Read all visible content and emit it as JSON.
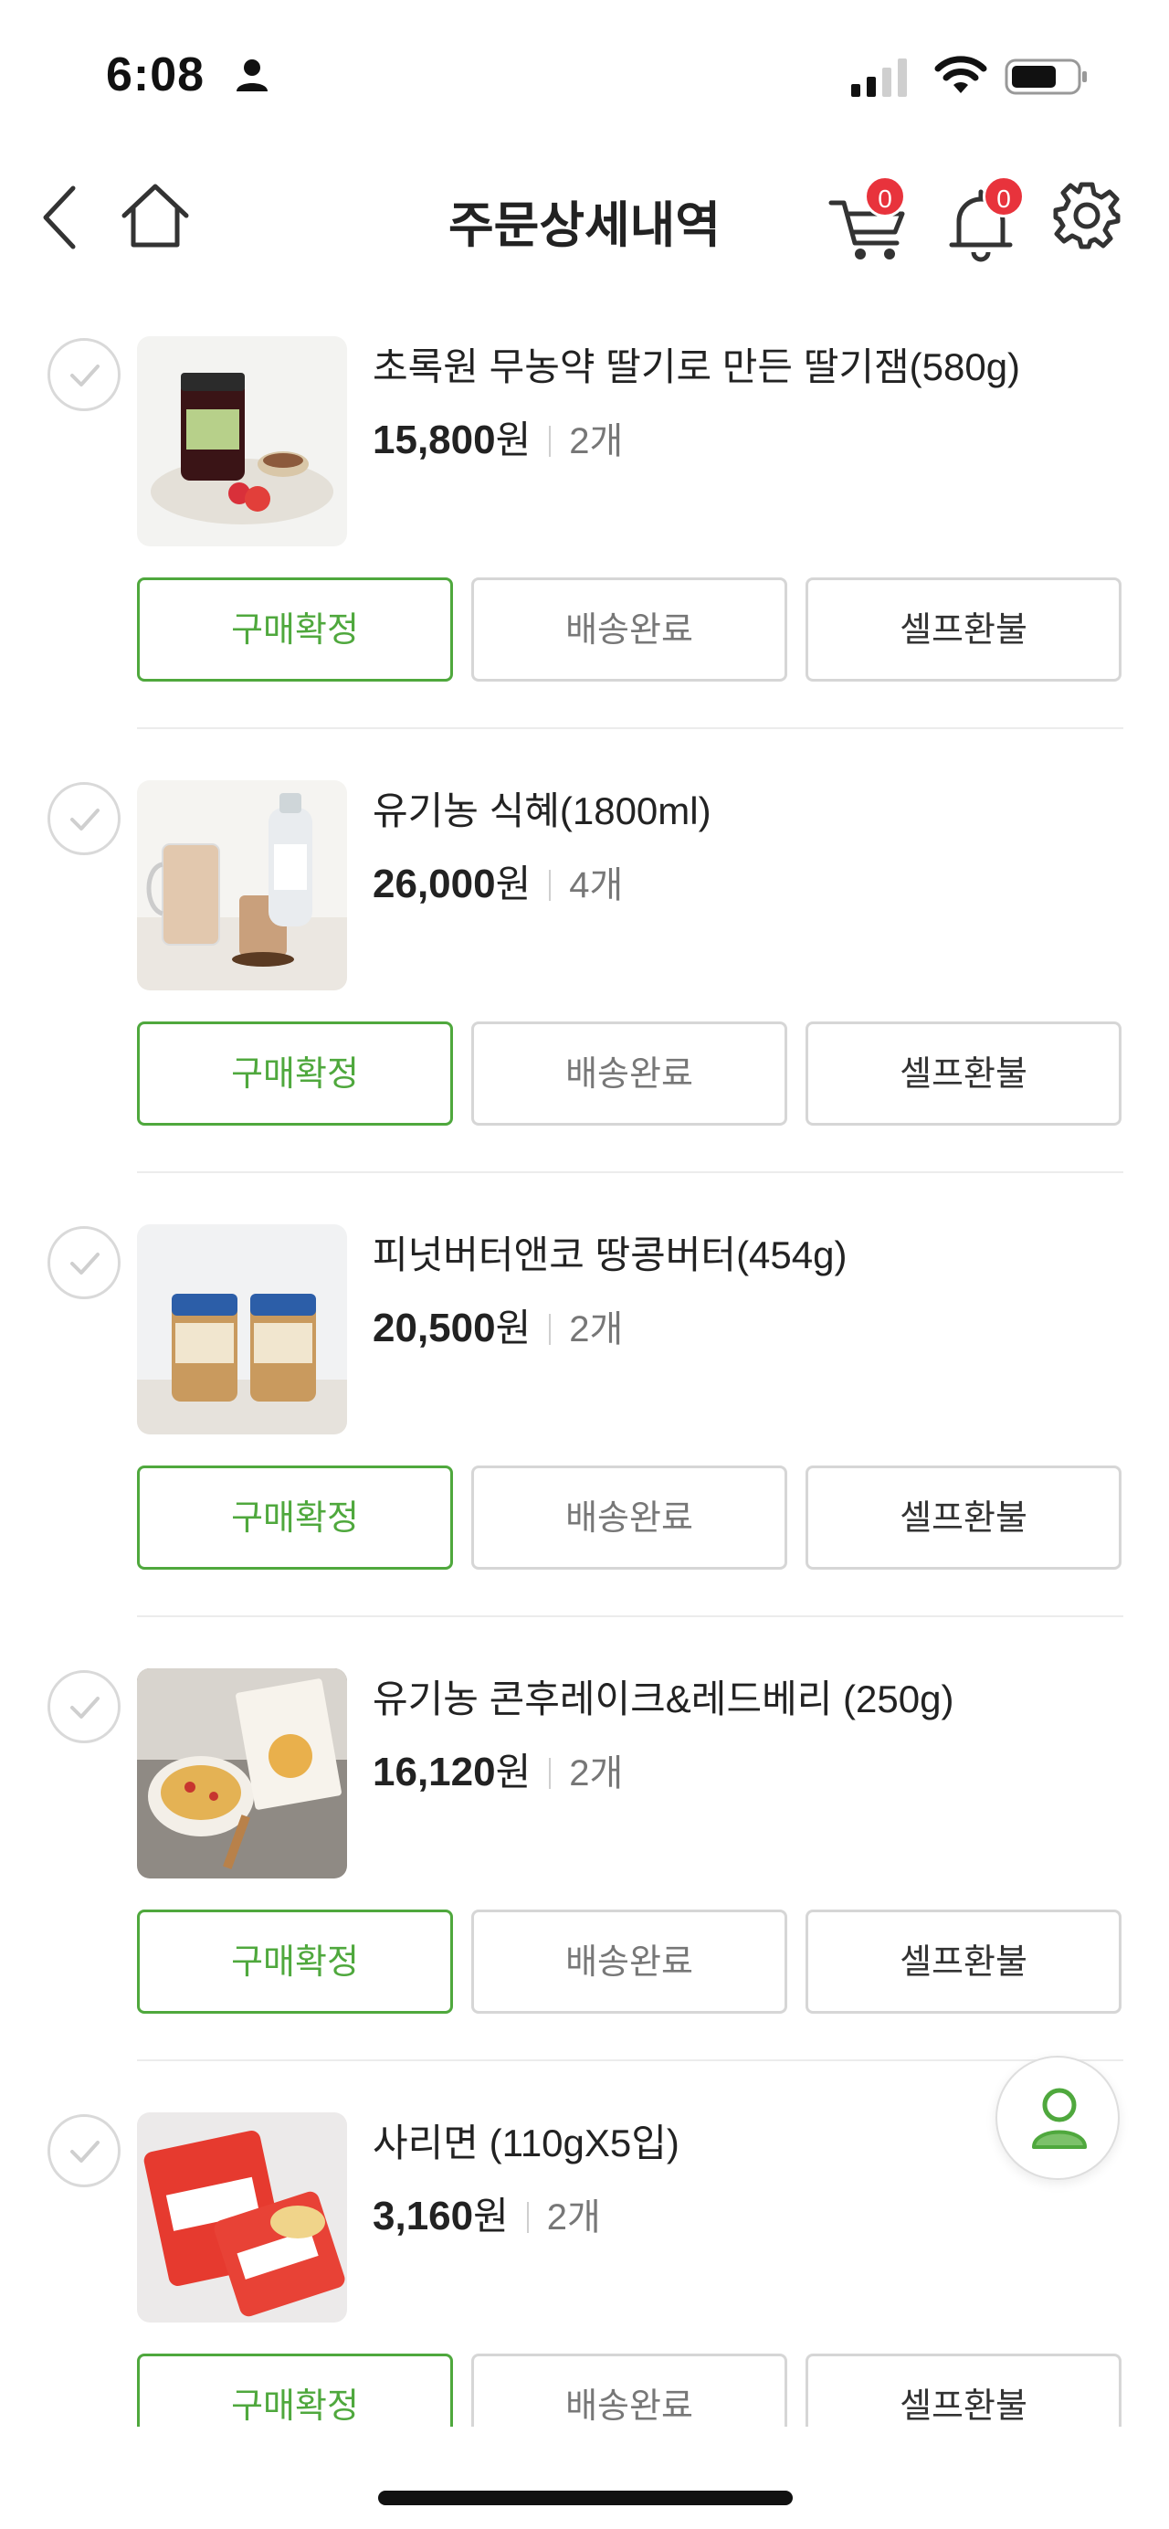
{
  "status_bar": {
    "time": "6:08"
  },
  "nav": {
    "title": "주문상세내역",
    "cart_count": "0",
    "notification_count": "0"
  },
  "actions": {
    "confirm": "구매확정",
    "delivered": "배송완료",
    "refund": "셀프환불"
  },
  "orders": [
    {
      "name": "초록원 무농약 딸기로 만든 딸기잼(580g)",
      "price": "15,800",
      "currency": "원",
      "quantity": "2개"
    },
    {
      "name": "유기농 식혜(1800ml)",
      "price": "26,000",
      "currency": "원",
      "quantity": "4개"
    },
    {
      "name": "피넛버터앤코 땅콩버터(454g)",
      "price": "20,500",
      "currency": "원",
      "quantity": "2개"
    },
    {
      "name": "유기농 콘후레이크&레드베리 (250g)",
      "price": "16,120",
      "currency": "원",
      "quantity": "2개"
    },
    {
      "name": "사리면 (110gX5입)",
      "price": "3,160",
      "currency": "원",
      "quantity": "2개"
    }
  ],
  "colors": {
    "accent": "#4fa83d",
    "badge": "#e8333c"
  },
  "icons": [
    "back-icon",
    "home-icon",
    "cart-icon",
    "bell-icon",
    "gear-icon",
    "check-icon",
    "profile-icon"
  ]
}
